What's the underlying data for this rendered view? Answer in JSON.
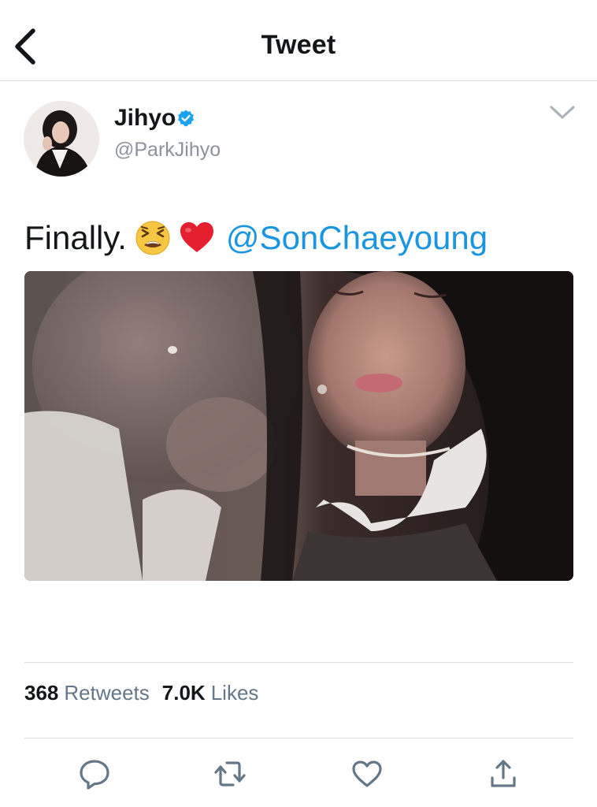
{
  "header": {
    "title": "Tweet",
    "back_icon": "chevron-left-icon"
  },
  "author": {
    "name": "Jihyo",
    "handle": "@ParkJihyo",
    "verified": true,
    "avatar": "profile-photo"
  },
  "tweet": {
    "text": "Finally.",
    "emojis": [
      "tired-face-emoji",
      "red-heart-emoji"
    ],
    "mention": "@SonChaeyoung",
    "media": "photo"
  },
  "stats": {
    "retweets_count": "368",
    "retweets_label": "Retweets",
    "likes_count": "7.0K",
    "likes_label": "Likes"
  },
  "actions": [
    "reply-icon",
    "retweet-icon",
    "like-icon",
    "share-icon"
  ],
  "colors": {
    "link": "#1b95e0",
    "secondary_text": "#657786",
    "handle_text": "#8a939b",
    "icon": "#657786",
    "divider": "#dadde0",
    "verified": "#1da1f2"
  }
}
